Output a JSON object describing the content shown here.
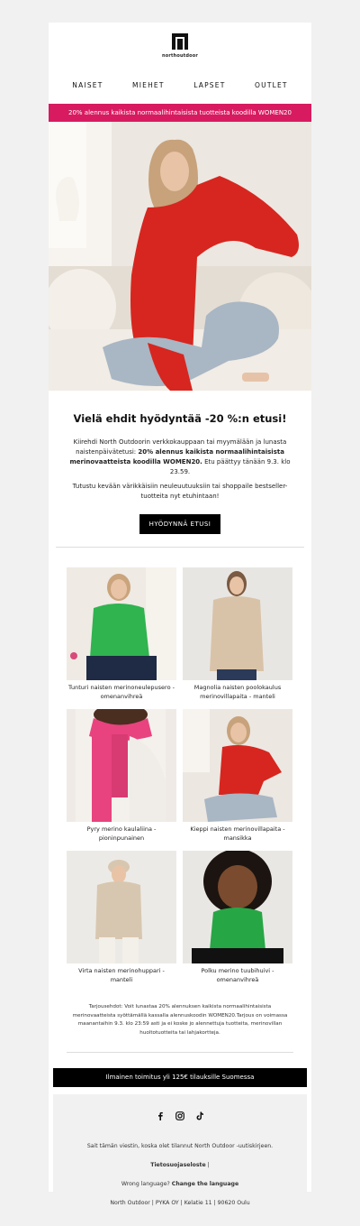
{
  "brand": {
    "name": "northoutdoor"
  },
  "nav": [
    {
      "label": "NAISET"
    },
    {
      "label": "MIEHET"
    },
    {
      "label": "LAPSET"
    },
    {
      "label": "OUTLET"
    }
  ],
  "promo_bar": "20% alennus kaikista normaalihintaisista tuotteista koodilla WOMEN20",
  "headline": "Vielä ehdit hyödyntää -20 %:n etusi!",
  "intro": {
    "before": "Kiirehdi North Outdoorin verkkokauppaan tai myymälään ja lunasta naistenpäivätetusi: ",
    "bold": "20% alennus kaikista normaalihintaisista merinovaatteista koodilla WOMEN20.",
    "after": " Etu päättyy tänään 9.3. klo 23.59."
  },
  "intro2": "Tutustu kevään värikkäisiin neuleuutuuksiin tai shoppaile bestseller-tuotteita nyt etuhintaan!",
  "cta": "HYÖDYNNÄ ETUSI",
  "products": [
    {
      "name": "Tunturi naisten merinoneulepusero - omenanvihreä",
      "color": "#2fb44f"
    },
    {
      "name": "Magnolia naisten poolokaulus merinovillapaita - manteli",
      "color": "#d9c3a8"
    },
    {
      "name": "Pyry merino kaulaliina - pioninpunainen",
      "color": "#e8437e"
    },
    {
      "name": "Kieppi naisten merinovillapaita - mansikka",
      "color": "#d7261f"
    },
    {
      "name": "Virta naisten merinohuppari - manteli",
      "color": "#d8c7b0"
    },
    {
      "name": "Polku merino tuubihuivi - omenanvihreä",
      "color": "#27a645"
    }
  ],
  "terms": "Tarjousehdot: Voit lunastaa 20% alennuksen kaikista normaalihintaisista merinovaatteista syöttämällä kassalla alennuskoodin WOMEN20.Tarjous on voimassa maanantaihin 9.3. klo 23:59 asti ja ei koske jo alennettuja tuotteita, merinovillan huoltotuotteita tai lahjakortteja.",
  "shipping": "Ilmainen toimitus yli 125€ tilauksille Suomessa",
  "footer": {
    "subscribed": "Sait tämän viestin, koska olet tilannut North Outdoor -uutiskirjeen.",
    "privacy": "Tietosuojaseloste",
    "privacy_sep": " |",
    "wrong_lang": "Wrong language? ",
    "change_lang": "Change the language",
    "address": "North Outdoor | PYKA OY | Kelatie 11 | 90620 Oulu"
  },
  "colors": {
    "promo": "#d81b60",
    "accent_red": "#d7261f"
  }
}
